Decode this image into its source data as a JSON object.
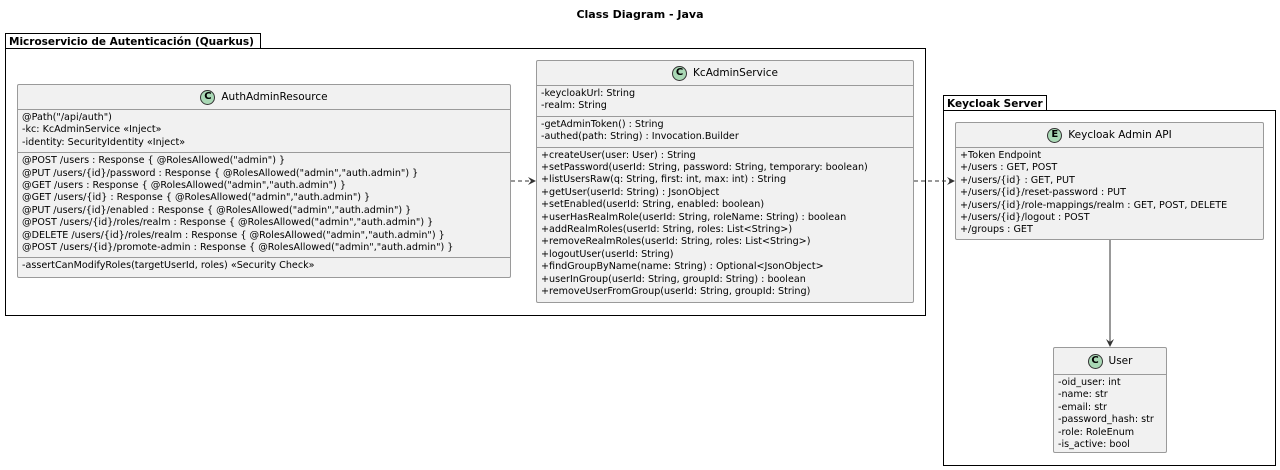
{
  "title": "Class Diagram - Java",
  "packages": {
    "auth": {
      "label": "Microservicio de Autenticación (Quarkus)"
    },
    "keycloak": {
      "label": "Keycloak Server"
    }
  },
  "classes": {
    "auth_admin_resource": {
      "name": "AuthAdminResource",
      "badge": "C",
      "fields": [
        "@Path(\"/api/auth\")",
        "-kc: KcAdminService «Inject»",
        "-identity: SecurityIdentity «Inject»"
      ],
      "endpoints": [
        "@POST /users : Response { @RolesAllowed(\"admin\") }",
        "@PUT /users/{id}/password : Response { @RolesAllowed(\"admin\",\"auth.admin\") }",
        "@GET /users : Response { @RolesAllowed(\"admin\",\"auth.admin\") }",
        "@GET /users/{id} : Response { @RolesAllowed(\"admin\",\"auth.admin\") }",
        "@PUT /users/{id}/enabled : Response { @RolesAllowed(\"admin\",\"auth.admin\") }",
        "@POST /users/{id}/roles/realm : Response { @RolesAllowed(\"admin\",\"auth.admin\") }",
        "@DELETE /users/{id}/roles/realm : Response { @RolesAllowed(\"admin\",\"auth.admin\") }",
        "@POST /users/{id}/promote-admin : Response { @RolesAllowed(\"admin\",\"auth.admin\") }"
      ],
      "methods": [
        "-assertCanModifyRoles(targetUserId, roles) «Security Check»"
      ]
    },
    "kc_admin_service": {
      "name": "KcAdminService",
      "badge": "C",
      "fields": [
        "-keycloakUrl: String",
        "-realm: String"
      ],
      "private_methods": [
        "-getAdminToken() : String",
        "-authed(path: String) : Invocation.Builder"
      ],
      "methods": [
        "+createUser(user: User) : String",
        "+setPassword(userId: String, password: String, temporary: boolean)",
        "+listUsersRaw(q: String, first: int, max: int) : String",
        "+getUser(userId: String) : JsonObject",
        "+setEnabled(userId: String, enabled: boolean)",
        "+userHasRealmRole(userId: String, roleName: String) : boolean",
        "+addRealmRoles(userId: String, roles: List<String>)",
        "+removeRealmRoles(userId: String, roles: List<String>)",
        "+logoutUser(userId: String)",
        "+findGroupByName(name: String) : Optional<JsonObject>",
        "+userInGroup(userId: String, groupId: String) : boolean",
        "+removeUserFromGroup(userId: String, groupId: String)"
      ]
    },
    "keycloak_admin_api": {
      "name": "Keycloak Admin API",
      "badge": "E",
      "items": [
        "+Token Endpoint",
        "+/users : GET, POST",
        "+/users/{id} : GET, PUT",
        "+/users/{id}/reset-password : PUT",
        "+/users/{id}/role-mappings/realm : GET, POST, DELETE",
        "+/users/{id}/logout : POST",
        "+/groups : GET"
      ]
    },
    "user": {
      "name": "User",
      "badge": "C",
      "fields": [
        "-oid_user: int",
        "-name: str",
        "-email: str",
        "-password_hash: str",
        "-role: RoleEnum",
        "-is_active: bool"
      ]
    }
  },
  "colors": {
    "class_fill": "#f1f1f1",
    "class_border": "#9a9a9a",
    "badge_fill": "#a9d8b5",
    "edge": "#333333"
  }
}
